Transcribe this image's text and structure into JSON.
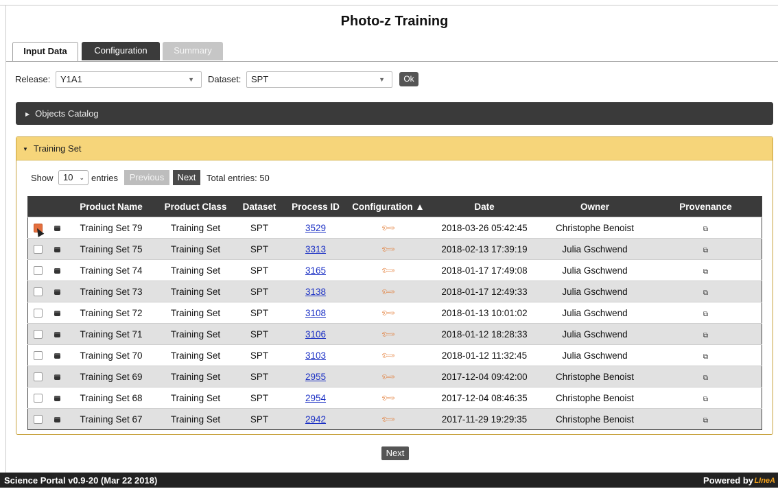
{
  "page": {
    "title": "Photo-z Training"
  },
  "tabs": [
    {
      "label": "Input Data"
    },
    {
      "label": "Configuration"
    },
    {
      "label": "Summary"
    }
  ],
  "filters": {
    "release_label": "Release:",
    "release_value": "Y1A1",
    "dataset_label": "Dataset:",
    "dataset_value": "SPT",
    "ok_label": "Ok"
  },
  "objects_catalog": {
    "label": "Objects Catalog"
  },
  "training_set": {
    "label": "Training Set",
    "show_label": "Show",
    "entries_value": "10",
    "entries_label": "entries",
    "previous_label": "Previous",
    "next_label": "Next",
    "total_entries": "Total entries: 50",
    "columns": [
      "",
      "",
      "Product Name",
      "Product Class",
      "Dataset",
      "Process ID",
      "Configuration ▲",
      "Date",
      "Owner",
      "Provenance"
    ],
    "rows": [
      {
        "checked": true,
        "name": "Training Set 79",
        "class": "Training Set",
        "dataset": "SPT",
        "process_id": "3529",
        "date": "2018-03-26 05:42:45",
        "owner": "Christophe Benoist"
      },
      {
        "checked": false,
        "name": "Training Set 75",
        "class": "Training Set",
        "dataset": "SPT",
        "process_id": "3313",
        "date": "2018-02-13 17:39:19",
        "owner": "Julia Gschwend"
      },
      {
        "checked": false,
        "name": "Training Set 74",
        "class": "Training Set",
        "dataset": "SPT",
        "process_id": "3165",
        "date": "2018-01-17 17:49:08",
        "owner": "Julia Gschwend"
      },
      {
        "checked": false,
        "name": "Training Set 73",
        "class": "Training Set",
        "dataset": "SPT",
        "process_id": "3138",
        "date": "2018-01-17 12:49:33",
        "owner": "Julia Gschwend"
      },
      {
        "checked": false,
        "name": "Training Set 72",
        "class": "Training Set",
        "dataset": "SPT",
        "process_id": "3108",
        "date": "2018-01-13 10:01:02",
        "owner": "Julia Gschwend"
      },
      {
        "checked": false,
        "name": "Training Set 71",
        "class": "Training Set",
        "dataset": "SPT",
        "process_id": "3106",
        "date": "2018-01-12 18:28:33",
        "owner": "Julia Gschwend"
      },
      {
        "checked": false,
        "name": "Training Set 70",
        "class": "Training Set",
        "dataset": "SPT",
        "process_id": "3103",
        "date": "2018-01-12 11:32:45",
        "owner": "Julia Gschwend"
      },
      {
        "checked": false,
        "name": "Training Set 69",
        "class": "Training Set",
        "dataset": "SPT",
        "process_id": "2955",
        "date": "2017-12-04 09:42:00",
        "owner": "Christophe Benoist"
      },
      {
        "checked": false,
        "name": "Training Set 68",
        "class": "Training Set",
        "dataset": "SPT",
        "process_id": "2954",
        "date": "2017-12-04 08:46:35",
        "owner": "Christophe Benoist"
      },
      {
        "checked": false,
        "name": "Training Set 67",
        "class": "Training Set",
        "dataset": "SPT",
        "process_id": "2942",
        "date": "2017-11-29 19:29:35",
        "owner": "Christophe Benoist"
      }
    ]
  },
  "bottom": {
    "next_label": "Next"
  },
  "footer": {
    "version": "Science Portal v0.9-20 (Mar 22 2018)",
    "powered_by": "Powered by",
    "logo_text": "LIneA"
  },
  "icons": {
    "view": "view-icon",
    "configuration": "wrench-icon",
    "provenance": "external-link-icon"
  },
  "colors": {
    "header_dark": "#3a3a3a",
    "training_set_header": "#f6d57a",
    "link": "#1a2fc4",
    "wrench": "#e2762c",
    "checkbox_checked": "#e36f3e"
  }
}
